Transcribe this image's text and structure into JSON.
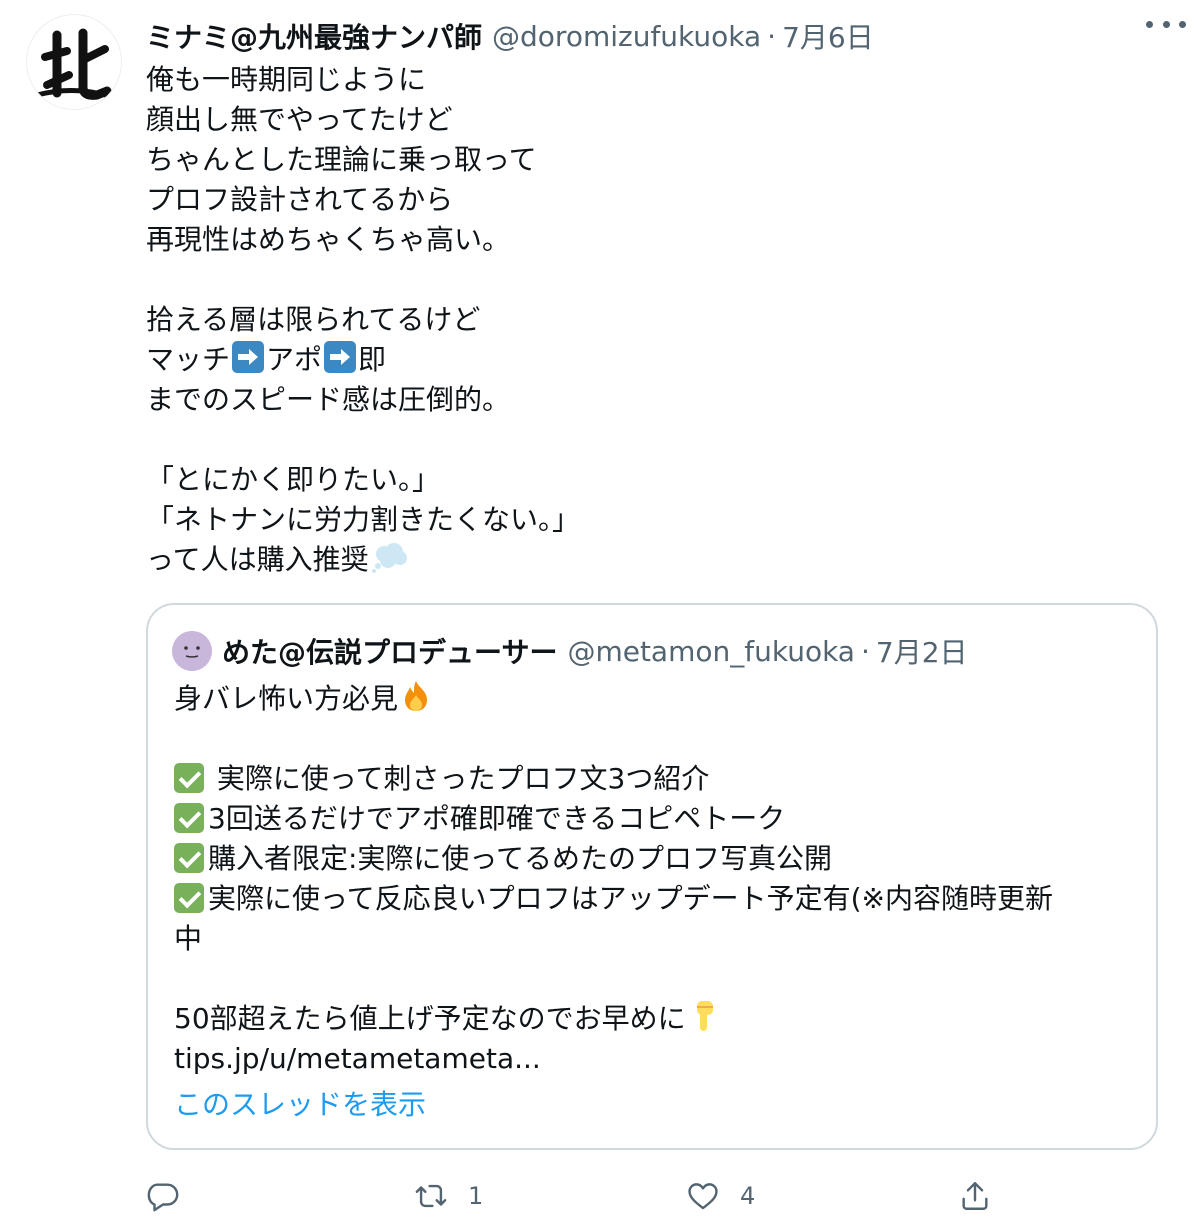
{
  "tweet": {
    "author": {
      "display_name": "ミナミ@九州最強ナンパ師",
      "handle": "@doromizufukuoka",
      "avatar_icon": "kanji-avatar-icon"
    },
    "separator": "·",
    "date": "7月6日",
    "more_icon": "ellipsis-icon",
    "lines": [
      "俺も一時期同じように",
      "顔出し無でやってたけど",
      "ちゃんとした理論に乗っ取って",
      "プロフ設計されてるから",
      "再現性はめちゃくちゃ高い。",
      "",
      "拾える層は限られてるけど",
      "マッチ",
      "アポ",
      "即",
      "までのスピード感は圧倒的。",
      "",
      "「とにかく即りたい。」",
      "「ネトナンに労力割きたくない。」",
      "って人は購入推奨"
    ]
  },
  "quote": {
    "author": {
      "display_name": "めた@伝説プロデューサー",
      "handle": "@metamon_fukuoka"
    },
    "separator": "·",
    "date": "7月2日",
    "lines": [
      "身バレ怖い方必見",
      "",
      " 実際に使って刺さったプロフ文3つ紹介",
      "3回送るだけでアポ確即確できるコピペトーク",
      "購入者限定:実際に使ってるめたのプロフ写真公開",
      "実際に使って反応良いプロフはアップデート予定有(※内容随時更新",
      "中",
      "",
      "50部超えたら値上げ予定なのでお早めに",
      "tips.jp/u/metametameta..."
    ],
    "show_thread": "このスレッドを表示"
  },
  "actions": {
    "reply": {
      "icon": "reply-icon",
      "count": ""
    },
    "retweet": {
      "icon": "retweet-icon",
      "count": "1"
    },
    "like": {
      "icon": "heart-icon",
      "count": "4"
    },
    "share": {
      "icon": "share-icon",
      "count": ""
    }
  },
  "colors": {
    "text": "#0f1419",
    "secondary": "#536471",
    "link": "#1d9bf0",
    "border": "#cfd9de",
    "check_green": "#78b159",
    "arrow_blue": "#3b88c3"
  }
}
